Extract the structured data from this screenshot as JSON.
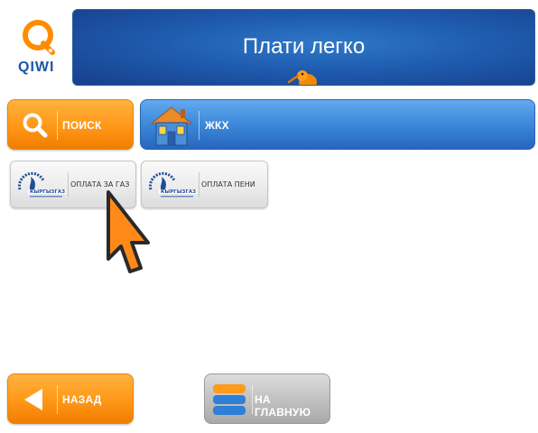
{
  "brand": {
    "name": "QIWI",
    "logo_icon": "qiwi-logo-icon",
    "color": "#1a57a6"
  },
  "banner": {
    "title": "Плати легко",
    "mascot_icon": "kiwi-bird-icon"
  },
  "search_button": {
    "label": "ПОИСК",
    "icon": "magnifier-icon"
  },
  "category": {
    "label": "ЖКХ",
    "icon": "house-icon"
  },
  "services": [
    {
      "label": "ОПЛАТА ЗА ГАЗ",
      "logo_text": "КЫРГЫЗГАЗ",
      "icon": "kyrgyzgaz-logo-icon"
    },
    {
      "label": "ОПЛАТА ПЕНИ",
      "logo_text": "КЫРГЫЗГАЗ",
      "icon": "kyrgyzgaz-logo-icon"
    }
  ],
  "back_button": {
    "label": "НАЗАД",
    "icon": "arrow-left-icon"
  },
  "home_button": {
    "label": "НА ГЛАВНУЮ",
    "icon": "home-stack-icon"
  },
  "colors": {
    "accent_orange": "#ff9a1a",
    "accent_blue": "#3b88da",
    "banner_blue": "#1f5cb0"
  }
}
